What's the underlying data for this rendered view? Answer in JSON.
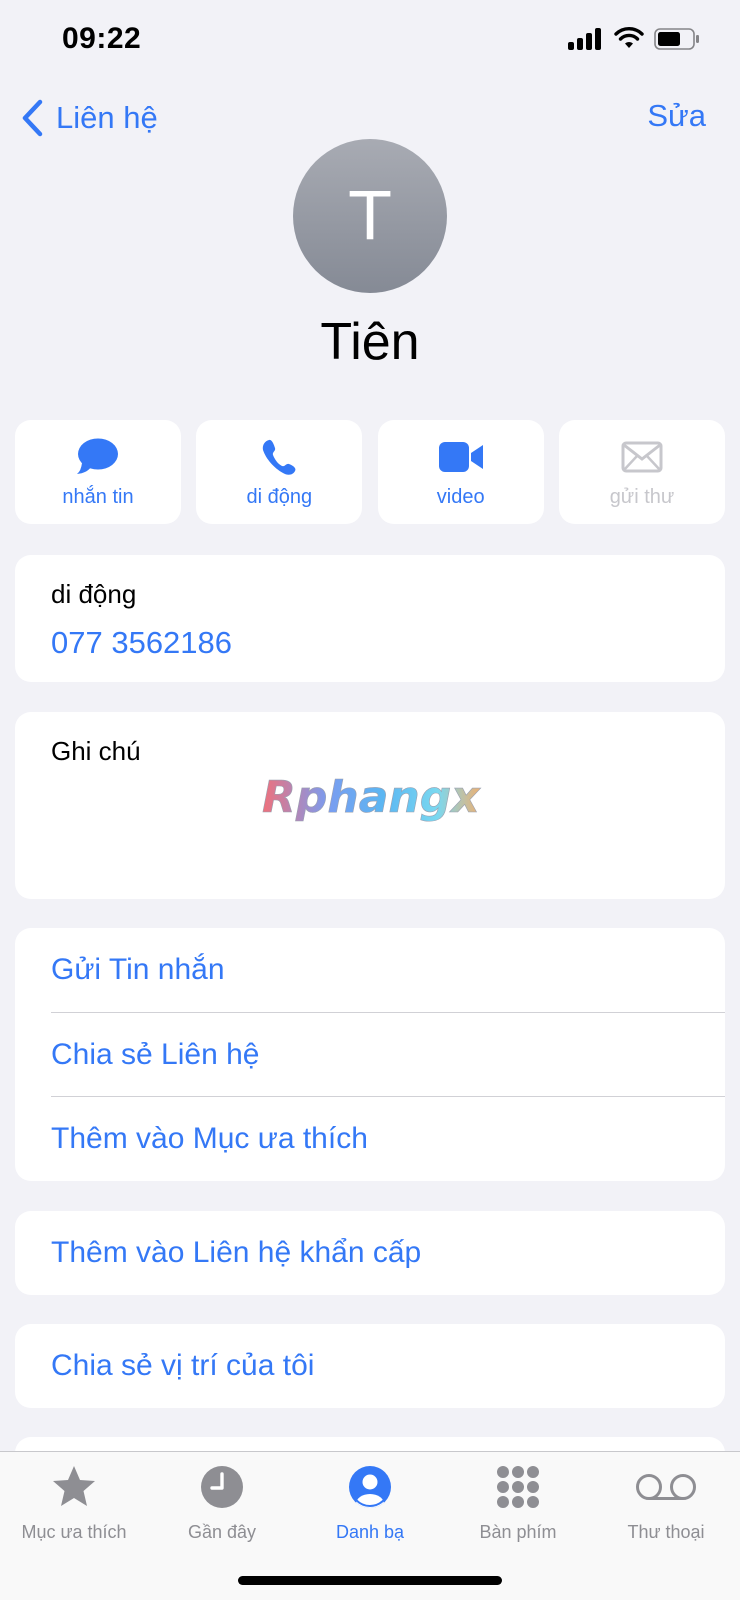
{
  "status_bar": {
    "time": "09:22"
  },
  "nav": {
    "back_label": "Liên hệ",
    "edit_label": "Sửa"
  },
  "contact": {
    "initial": "T",
    "name": "Tiên"
  },
  "actions": [
    {
      "label": "nhắn tin",
      "icon": "message-icon",
      "enabled": true
    },
    {
      "label": "di động",
      "icon": "phone-icon",
      "enabled": true
    },
    {
      "label": "video",
      "icon": "video-icon",
      "enabled": true
    },
    {
      "label": "gửi thư",
      "icon": "mail-icon",
      "enabled": false
    }
  ],
  "phone": {
    "label": "di động",
    "number": "077 3562186"
  },
  "notes": {
    "label": "Ghi chú",
    "watermark_text": "Rphangx"
  },
  "options": [
    "Gửi Tin nhắn",
    "Chia sẻ Liên hệ",
    "Thêm vào Mục ưa thích"
  ],
  "emergency": "Thêm vào Liên hệ khẩn cấp",
  "share_location": "Chia sẻ vị trí của tôi",
  "tabs": [
    {
      "label": "Mục ưa thích",
      "icon": "star-icon",
      "active": false
    },
    {
      "label": "Gần đây",
      "icon": "clock-icon",
      "active": false
    },
    {
      "label": "Danh bạ",
      "icon": "person-circle-icon",
      "active": true
    },
    {
      "label": "Bàn phím",
      "icon": "keypad-icon",
      "active": false
    },
    {
      "label": "Thư thoại",
      "icon": "voicemail-icon",
      "active": false
    }
  ],
  "colors": {
    "accent": "#3478f6",
    "background": "#f2f2f7",
    "inactive": "#8e8e93",
    "disabled": "#c7c7cc"
  }
}
